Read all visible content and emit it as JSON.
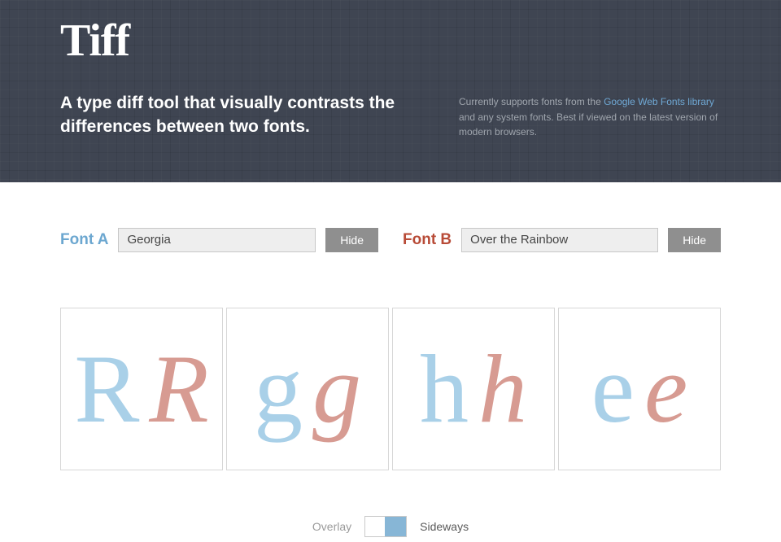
{
  "header": {
    "logo": "Tiff",
    "tagline": "A type diff tool that visually contrasts the differences between two fonts.",
    "support_prefix": "Currently supports fonts from the ",
    "support_link": "Google Web Fonts library",
    "support_suffix": " and any system fonts. Best if viewed on the latest version of modern browsers."
  },
  "fontA": {
    "label": "Font A",
    "value": "Georgia",
    "hide": "Hide"
  },
  "fontB": {
    "label": "Font B",
    "value": "Over the Rainbow",
    "hide": "Hide"
  },
  "letters": [
    "R",
    "g",
    "h",
    "e"
  ],
  "toggle": {
    "left": "Overlay",
    "right": "Sideways"
  }
}
